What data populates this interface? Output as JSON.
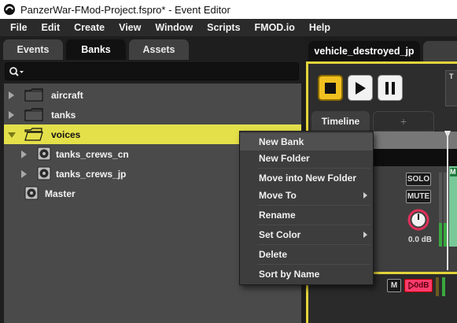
{
  "titlebar": {
    "title": "PanzerWar-FMod-Project.fspro* - Event Editor"
  },
  "menubar": {
    "items": [
      "File",
      "Edit",
      "Create",
      "View",
      "Window",
      "Scripts",
      "FMOD.io",
      "Help"
    ]
  },
  "browser": {
    "tabs": [
      "Events",
      "Banks",
      "Assets"
    ],
    "active_tab": "Banks",
    "tree": [
      {
        "label": "aircraft",
        "kind": "folder",
        "expanded": false
      },
      {
        "label": "tanks",
        "kind": "folder",
        "expanded": false
      },
      {
        "label": "voices",
        "kind": "folder",
        "expanded": true,
        "selected": true
      },
      {
        "label": "tanks_crews_cn",
        "kind": "bank"
      },
      {
        "label": "tanks_crews_jp",
        "kind": "bank"
      },
      {
        "label": "Master",
        "kind": "bank"
      }
    ]
  },
  "editor": {
    "event_tab": "vehicle_destroyed_jp",
    "event_tab_add": "+",
    "side_letter": "T",
    "timeline_tab": "Timeline",
    "timeline_add": "+",
    "solo_label": "SOLO",
    "mute_label": "MUTE",
    "volume": "0.0 dB",
    "region_letter": "M",
    "master_m_label": "M",
    "master_0db_label": "0dB"
  },
  "context_menu": {
    "items": [
      {
        "label": "New Bank",
        "hover": true
      },
      {
        "label": "New Folder"
      },
      {
        "label": "Move into New Folder"
      },
      {
        "label": "Move To",
        "submenu": true
      },
      {
        "label": "Rename"
      },
      {
        "label": "Set Color",
        "submenu": true
      },
      {
        "label": "Delete"
      },
      {
        "label": "Sort by Name"
      }
    ]
  },
  "colors": {
    "selection": "#e4e04a",
    "accent_gold": "#f0c020",
    "panel": "#4a4a4a"
  }
}
